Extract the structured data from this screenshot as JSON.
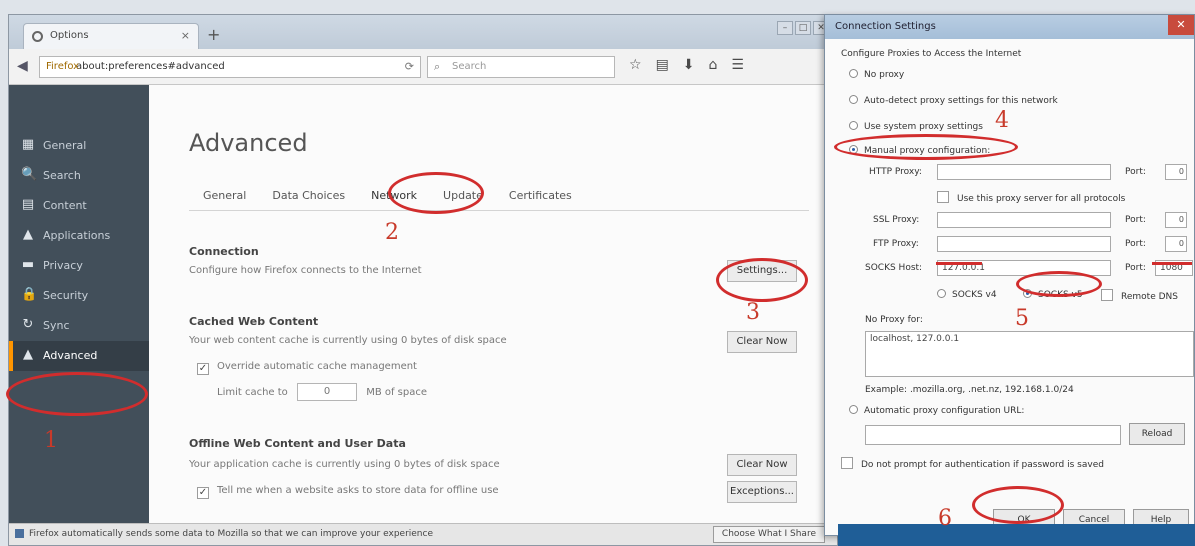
{
  "browser": {
    "tab_title": "Options",
    "tab_close": "×",
    "new_tab": "+",
    "url_identity": "Firefox",
    "url": "about:preferences#advanced",
    "reload": "⟳",
    "search_placeholder": "Search",
    "toolbar_icons": [
      "☆",
      "▤",
      "⬇",
      "⌂",
      "☰"
    ]
  },
  "sidebar": {
    "items": [
      {
        "icon": "▦",
        "label": "General"
      },
      {
        "icon": "🔍",
        "label": "Search"
      },
      {
        "icon": "▤",
        "label": "Content"
      },
      {
        "icon": "▲",
        "label": "Applications"
      },
      {
        "icon": "▬",
        "label": "Privacy"
      },
      {
        "icon": "🔒",
        "label": "Security"
      },
      {
        "icon": "↻",
        "label": "Sync"
      },
      {
        "icon": "▲",
        "label": "Advanced"
      }
    ]
  },
  "advanced": {
    "title": "Advanced",
    "tabs": [
      "General",
      "Data Choices",
      "Network",
      "Update",
      "Certificates"
    ],
    "connection": {
      "heading": "Connection",
      "desc": "Configure how Firefox connects to the Internet",
      "button": "Settings..."
    },
    "cached": {
      "heading": "Cached Web Content",
      "desc": "Your web content cache is currently using 0 bytes of disk space",
      "button": "Clear Now",
      "override": "Override automatic cache management",
      "limit_prefix": "Limit cache to",
      "limit_value": "0",
      "limit_suffix": "MB of space"
    },
    "offline": {
      "heading": "Offline Web Content and User Data",
      "desc": "Your application cache is currently using 0 bytes of disk space",
      "button": "Clear Now",
      "tell_me": "Tell me when a website asks to store data for offline use",
      "exceptions": "Exceptions..."
    }
  },
  "statusbar": {
    "text": "Firefox automatically sends some data to Mozilla so that we can improve your experience",
    "button": "Choose What I Share"
  },
  "dialog": {
    "title": "Connection Settings",
    "close": "✕",
    "group_label": "Configure Proxies to Access the Internet",
    "options": [
      "No proxy",
      "Auto-detect proxy settings for this network",
      "Use system proxy settings",
      "Manual proxy configuration:"
    ],
    "http_label": "HTTP Proxy:",
    "port_label": "Port:",
    "use_all": "Use this proxy server for all protocols",
    "ssl_label": "SSL Proxy:",
    "ftp_label": "FTP Proxy:",
    "socks_label": "SOCKS Host:",
    "socks_value": "127.0.0.1",
    "socks_port": "1080",
    "socks4": "SOCKS v4",
    "socks5": "SOCKS v5",
    "remote_dns": "Remote DNS",
    "no_proxy_label": "No Proxy for:",
    "no_proxy_value": "localhost, 127.0.0.1",
    "example": "Example: .mozilla.org, .net.nz, 192.168.1.0/24",
    "auto_config": "Automatic proxy configuration URL:",
    "reload": "Reload",
    "no_prompt": "Do not prompt for authentication if password is saved",
    "ok": "OK",
    "cancel": "Cancel",
    "help": "Help"
  },
  "annotations": [
    "1",
    "2",
    "3",
    "4",
    "5",
    "6"
  ],
  "colors": {
    "annotation": "#d12d2d",
    "sidebar": "#424f5a",
    "accent": "#ff9500"
  }
}
